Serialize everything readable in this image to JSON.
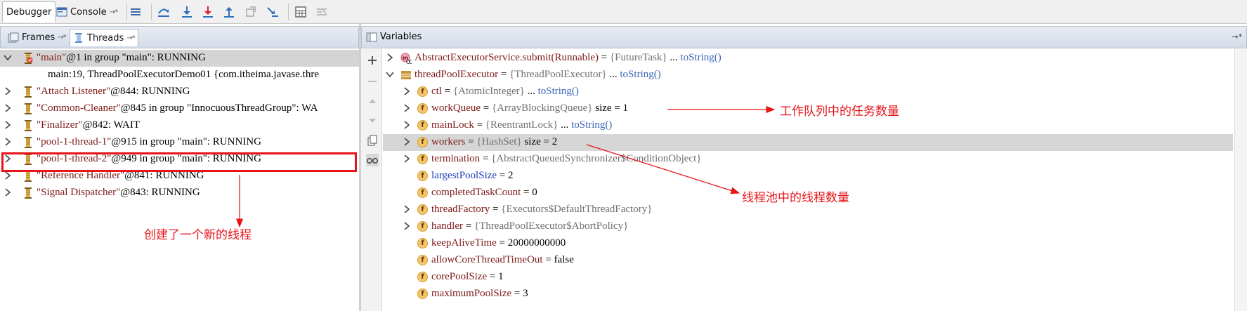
{
  "toolbar": {
    "debugger_tab": "Debugger",
    "console_tab": "Console",
    "console_pin": "→*"
  },
  "left_panel": {
    "frames_tab": "Frames",
    "threads_tab": "Threads",
    "tab_pin": "→*",
    "threads": [
      {
        "name": "\"main\"",
        "suffix": "@1 in group \"main\": RUNNING",
        "expanded": true,
        "selected": true,
        "icon": "thread-paused-icon"
      },
      {
        "frame": "main:19, ThreadPoolExecutorDemo01 {com.itheima.javase.thre"
      },
      {
        "name": "\"Attach Listener\"",
        "suffix": "@844: RUNNING",
        "icon": "thread-icon"
      },
      {
        "name": "\"Common-Cleaner\"",
        "suffix": "@845 in group \"InnocuousThreadGroup\": WA",
        "icon": "thread-icon"
      },
      {
        "name": "\"Finalizer\"",
        "suffix": "@842: WAIT",
        "icon": "thread-icon"
      },
      {
        "name": "\"pool-1-thread-1\"",
        "suffix": "@915 in group \"main\": RUNNING",
        "icon": "thread-icon"
      },
      {
        "name": "\"pool-1-thread-2\"",
        "suffix": "@949 in group \"main\": RUNNING",
        "icon": "thread-icon",
        "boxed": true
      },
      {
        "name": "\"Reference Handler\"",
        "suffix": "@841: RUNNING",
        "icon": "thread-icon"
      },
      {
        "name": "\"Signal Dispatcher\"",
        "suffix": "@843: RUNNING",
        "icon": "thread-icon"
      }
    ]
  },
  "right_panel": {
    "title": "Variables",
    "pin": "→*",
    "variables": [
      {
        "name": "AbstractExecutorService.submit(Runnable)",
        "eq": " = ",
        "type": "{FutureTask}",
        "link": "toString()",
        "level": 0,
        "expandable": true,
        "icon": "method-icon"
      },
      {
        "name": "threadPoolExecutor",
        "eq": " = ",
        "type": "{ThreadPoolExecutor}",
        "link": "toString()",
        "level": 0,
        "expandable": true,
        "expanded": true,
        "icon": "object-icon"
      },
      {
        "name": "ctl",
        "eq": " = ",
        "type": "{AtomicInteger}",
        "link": "toString()",
        "level": 1,
        "expandable": true,
        "icon": "field-icon"
      },
      {
        "name": "workQueue",
        "eq": " = ",
        "type": "{ArrayBlockingQueue}",
        "extra": "size = 1",
        "level": 1,
        "expandable": true,
        "icon": "field-icon"
      },
      {
        "name": "mainLock",
        "eq": " = ",
        "type": "{ReentrantLock}",
        "link": "toString()",
        "level": 1,
        "expandable": true,
        "icon": "field-icon"
      },
      {
        "name": "workers",
        "eq": " = ",
        "type": "{HashSet}",
        "extra": "size = 2",
        "level": 1,
        "expandable": true,
        "icon": "field-icon",
        "highlight": true
      },
      {
        "name": "termination",
        "eq": " = ",
        "type": "{AbstractQueuedSynchronizer$ConditionObject}",
        "level": 1,
        "expandable": true,
        "icon": "field-icon"
      },
      {
        "name": "largestPoolSize",
        "eq": " = ",
        "value": "2",
        "level": 1,
        "blue": true,
        "icon": "field-icon"
      },
      {
        "name": "completedTaskCount",
        "eq": " = ",
        "value": "0",
        "level": 1,
        "icon": "field-icon"
      },
      {
        "name": "threadFactory",
        "eq": " = ",
        "type": "{Executors$DefaultThreadFactory}",
        "level": 1,
        "expandable": true,
        "icon": "field-icon"
      },
      {
        "name": "handler",
        "eq": " = ",
        "type": "{ThreadPoolExecutor$AbortPolicy}",
        "level": 1,
        "expandable": true,
        "icon": "field-icon"
      },
      {
        "name": "keepAliveTime",
        "eq": " = ",
        "value": "20000000000",
        "level": 1,
        "icon": "field-icon"
      },
      {
        "name": "allowCoreThreadTimeOut",
        "eq": " = ",
        "value": "false",
        "level": 1,
        "icon": "field-icon"
      },
      {
        "name": "corePoolSize",
        "eq": " = ",
        "value": "1",
        "level": 1,
        "icon": "field-icon"
      },
      {
        "name": "maximumPoolSize",
        "eq": " = ",
        "value": "3",
        "level": 1,
        "icon": "field-icon"
      }
    ]
  },
  "annotations": {
    "queue_count": "工作队列中的任务数量",
    "thread_count": "线程池中的线程数量",
    "new_thread": "创建了一个新的线程",
    "color": "#e8141a"
  },
  "colors": {
    "name": "#7c1b17",
    "type": "#6f6f6f",
    "link": "#3a66b8",
    "highlight": "#d6d6d6"
  }
}
